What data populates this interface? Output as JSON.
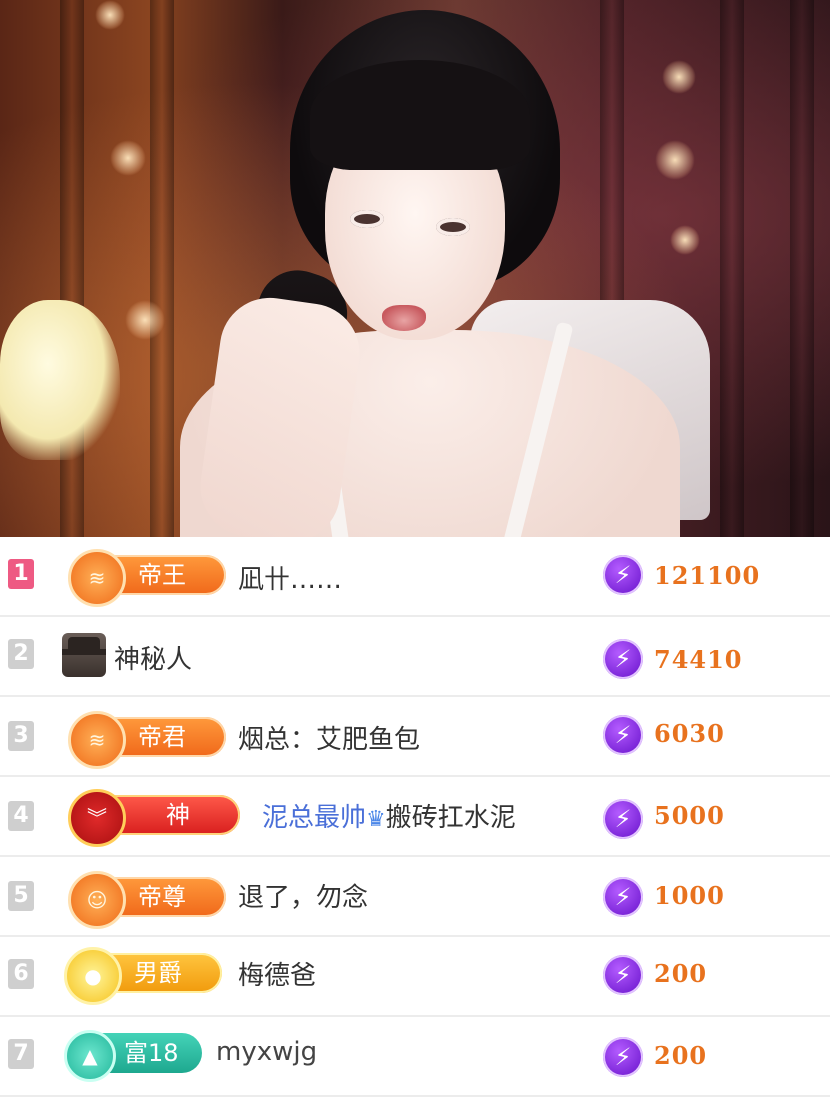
{
  "leaderboard": [
    {
      "rank": "1",
      "badge": {
        "label": "帝王",
        "style": "orange",
        "icon": "emperor-emblem-icon"
      },
      "name": "凪卄……",
      "amount": "121100"
    },
    {
      "rank": "2",
      "badge": null,
      "avatar": "mystery-person-icon",
      "name": "神秘人",
      "amount": "74410"
    },
    {
      "rank": "3",
      "badge": {
        "label": "帝君",
        "style": "orange",
        "icon": "emperor-emblem-icon"
      },
      "name": "烟总：艾肥鱼包",
      "amount": "6030"
    },
    {
      "rank": "4",
      "badge": {
        "label": "神",
        "style": "red",
        "icon": "god-emblem-icon"
      },
      "name": "泥总最帅",
      "name_suffix": "搬砖扛水泥",
      "amount": "5000"
    },
    {
      "rank": "5",
      "badge": {
        "label": "帝尊",
        "style": "orange",
        "icon": "emperor-emblem-icon"
      },
      "name": "退了，勿念",
      "amount": "1000"
    },
    {
      "rank": "6",
      "badge": {
        "label": "男爵",
        "style": "gold",
        "icon": "baron-emblem-icon"
      },
      "name": "梅德爸",
      "amount": "200"
    },
    {
      "rank": "7",
      "badge": {
        "label": "富18",
        "style": "teal",
        "icon": "wealth-emblem-icon"
      },
      "name": "myxwjg",
      "amount": "200"
    }
  ],
  "icons": {
    "gift": "lightning-gift-icon",
    "crown": "crown-icon"
  },
  "colors": {
    "amount": "#e8721e",
    "rank_first": "#ee5a83",
    "rank_other": "#cfcfcf",
    "gift": "#7b25d8"
  }
}
